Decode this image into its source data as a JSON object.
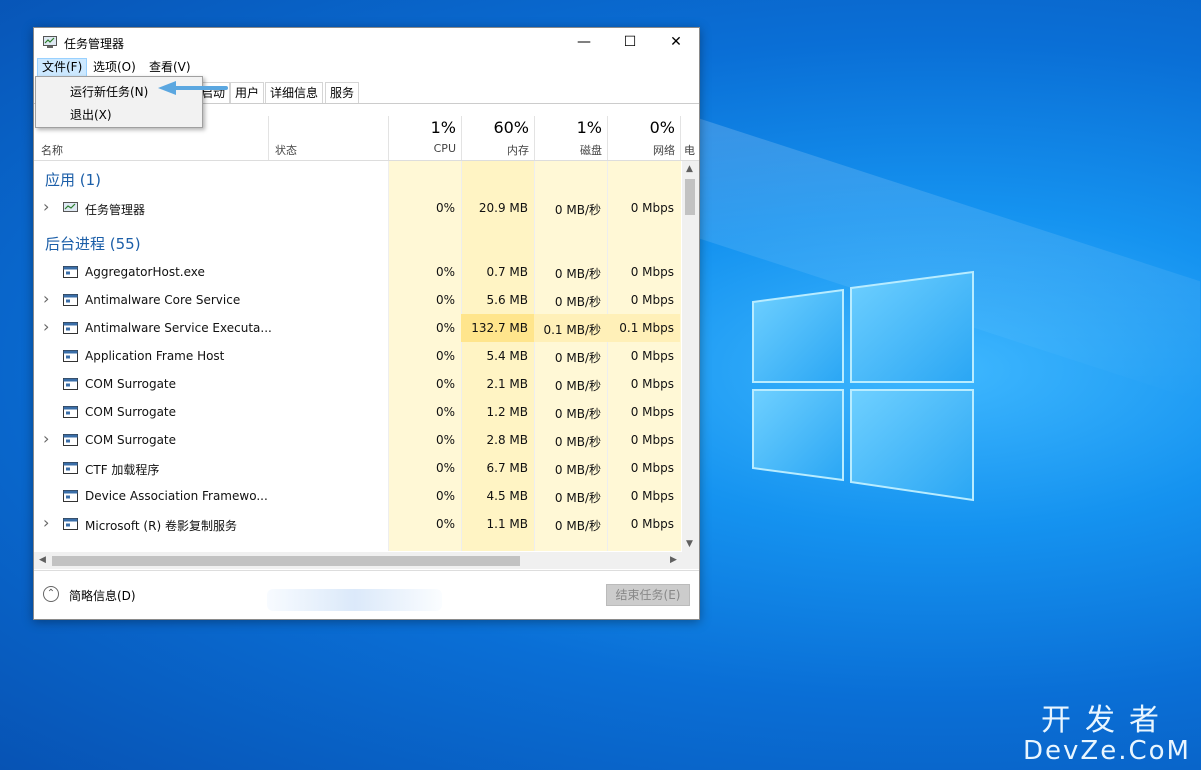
{
  "window": {
    "title": "任务管理器",
    "controls": {
      "minimize": "—",
      "maximize": "☐",
      "close": "✕"
    }
  },
  "menubar": {
    "file": "文件(F)",
    "options": "选项(O)",
    "view": "查看(V)"
  },
  "file_menu": {
    "run_new_task": "运行新任务(N)",
    "exit": "退出(X)"
  },
  "tabs": [
    "启动",
    "用户",
    "详细信息",
    "服务"
  ],
  "columns": {
    "name": "名称",
    "status": "状态",
    "cpu": {
      "percent": "1%",
      "label": "CPU"
    },
    "memory": {
      "percent": "60%",
      "label": "内存"
    },
    "disk": {
      "percent": "1%",
      "label": "磁盘"
    },
    "network": {
      "percent": "0%",
      "label": "网络"
    },
    "power": "电"
  },
  "groups": {
    "apps": "应用 (1)",
    "background": "后台进程 (55)"
  },
  "app_rows": [
    {
      "name": "任务管理器",
      "cpu": "0%",
      "memory": "20.9 MB",
      "disk": "0 MB/秒",
      "network": "0 Mbps",
      "expandable": true
    }
  ],
  "background_rows": [
    {
      "name": "AggregatorHost.exe",
      "cpu": "0%",
      "memory": "0.7 MB",
      "disk": "0 MB/秒",
      "network": "0 Mbps",
      "expandable": false
    },
    {
      "name": "Antimalware Core Service",
      "cpu": "0%",
      "memory": "5.6 MB",
      "disk": "0 MB/秒",
      "network": "0 Mbps",
      "expandable": true
    },
    {
      "name": "Antimalware Service Executa...",
      "cpu": "0%",
      "memory": "132.7 MB",
      "disk": "0.1 MB/秒",
      "network": "0.1 Mbps",
      "expandable": true
    },
    {
      "name": "Application Frame Host",
      "cpu": "0%",
      "memory": "5.4 MB",
      "disk": "0 MB/秒",
      "network": "0 Mbps",
      "expandable": false
    },
    {
      "name": "COM Surrogate",
      "cpu": "0%",
      "memory": "2.1 MB",
      "disk": "0 MB/秒",
      "network": "0 Mbps",
      "expandable": false
    },
    {
      "name": "COM Surrogate",
      "cpu": "0%",
      "memory": "1.2 MB",
      "disk": "0 MB/秒",
      "network": "0 Mbps",
      "expandable": false
    },
    {
      "name": "COM Surrogate",
      "cpu": "0%",
      "memory": "2.8 MB",
      "disk": "0 MB/秒",
      "network": "0 Mbps",
      "expandable": true
    },
    {
      "name": "CTF 加载程序",
      "cpu": "0%",
      "memory": "6.7 MB",
      "disk": "0 MB/秒",
      "network": "0 Mbps",
      "expandable": false
    },
    {
      "name": "Device Association Framewo...",
      "cpu": "0%",
      "memory": "4.5 MB",
      "disk": "0 MB/秒",
      "network": "0 Mbps",
      "expandable": false
    },
    {
      "name": "Microsoft (R) 卷影复制服务",
      "cpu": "0%",
      "memory": "1.1 MB",
      "disk": "0 MB/秒",
      "network": "0 Mbps",
      "expandable": true
    }
  ],
  "footer": {
    "fewer_details": "简略信息(D)",
    "end_task": "结束任务(E)"
  },
  "watermark": {
    "line1": "开发者",
    "line2": "DevZe.CoM"
  },
  "colors": {
    "heat_light": "#fff8d6",
    "heat_medium": "#fff0b8",
    "heat_strong": "#ffe58c",
    "group_text": "#1b5ea8",
    "menu_highlight": "#cce8ff",
    "arrow": "#5ba7e0"
  }
}
